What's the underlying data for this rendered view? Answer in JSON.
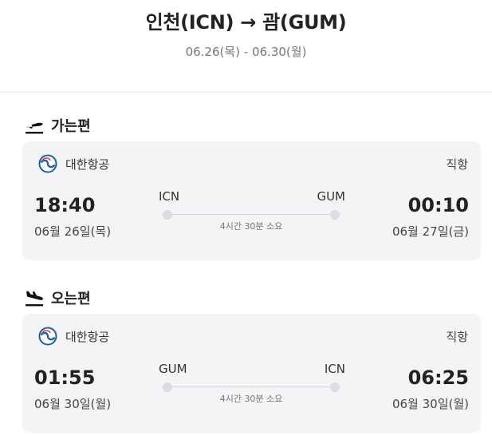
{
  "header": {
    "route": "인천(ICN) → 괌(GUM)",
    "dates": "06.26(목) - 06.30(월)"
  },
  "outbound": {
    "section_title": "가는편",
    "section_icon": "airplane-takeoff-icon",
    "airline_logo": "korean-air-logo",
    "airline": "대한항공",
    "flight_type": "직항",
    "departure": {
      "time": "18:40",
      "date": "06월 26일(목)",
      "airport": "ICN"
    },
    "arrival": {
      "time": "00:10",
      "date": "06월 27일(금)",
      "airport": "GUM"
    },
    "duration": "4시간 30분 소요"
  },
  "inbound": {
    "section_title": "오는편",
    "section_icon": "airplane-landing-icon",
    "airline_logo": "korean-air-logo",
    "airline": "대한항공",
    "flight_type": "직항",
    "departure": {
      "time": "01:55",
      "date": "06월 30일(월)",
      "airport": "GUM"
    },
    "arrival": {
      "time": "06:25",
      "date": "06월 30일(월)",
      "airport": "ICN"
    },
    "duration": "4시간 30분 소요"
  },
  "colors": {
    "card_background": "#f3f4f6",
    "logo_blue": "#1f5fa8",
    "text_primary": "#222222",
    "text_secondary": "#777777"
  }
}
